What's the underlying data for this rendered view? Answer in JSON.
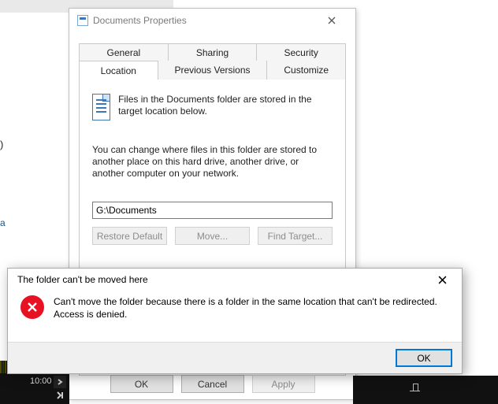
{
  "properties_dialog": {
    "title": "Documents Properties",
    "tabs_row1": [
      "General",
      "Sharing",
      "Security"
    ],
    "tabs_row2": [
      "Location",
      "Previous Versions",
      "Customize"
    ],
    "active_tab": "Location",
    "info_text": "Files in the Documents folder are stored in the target location below.",
    "change_text": "You can change where files in this folder are stored to another place on this hard drive, another drive, or another computer on your network.",
    "path_value": "G:\\Documents",
    "buttons": {
      "restore": "Restore Default",
      "move": "Move...",
      "find": "Find Target..."
    },
    "footer": {
      "ok": "OK",
      "cancel": "Cancel",
      "apply": "Apply"
    }
  },
  "error_dialog": {
    "title": "The folder can't be moved here",
    "message": "Can't move the folder because there is a folder in the same location that can't be redirected.",
    "message2": "Access is denied.",
    "ok": "OK"
  },
  "background": {
    "link_fragment": "a",
    "paren_fragment": ")",
    "timeline_time": "10:00"
  }
}
